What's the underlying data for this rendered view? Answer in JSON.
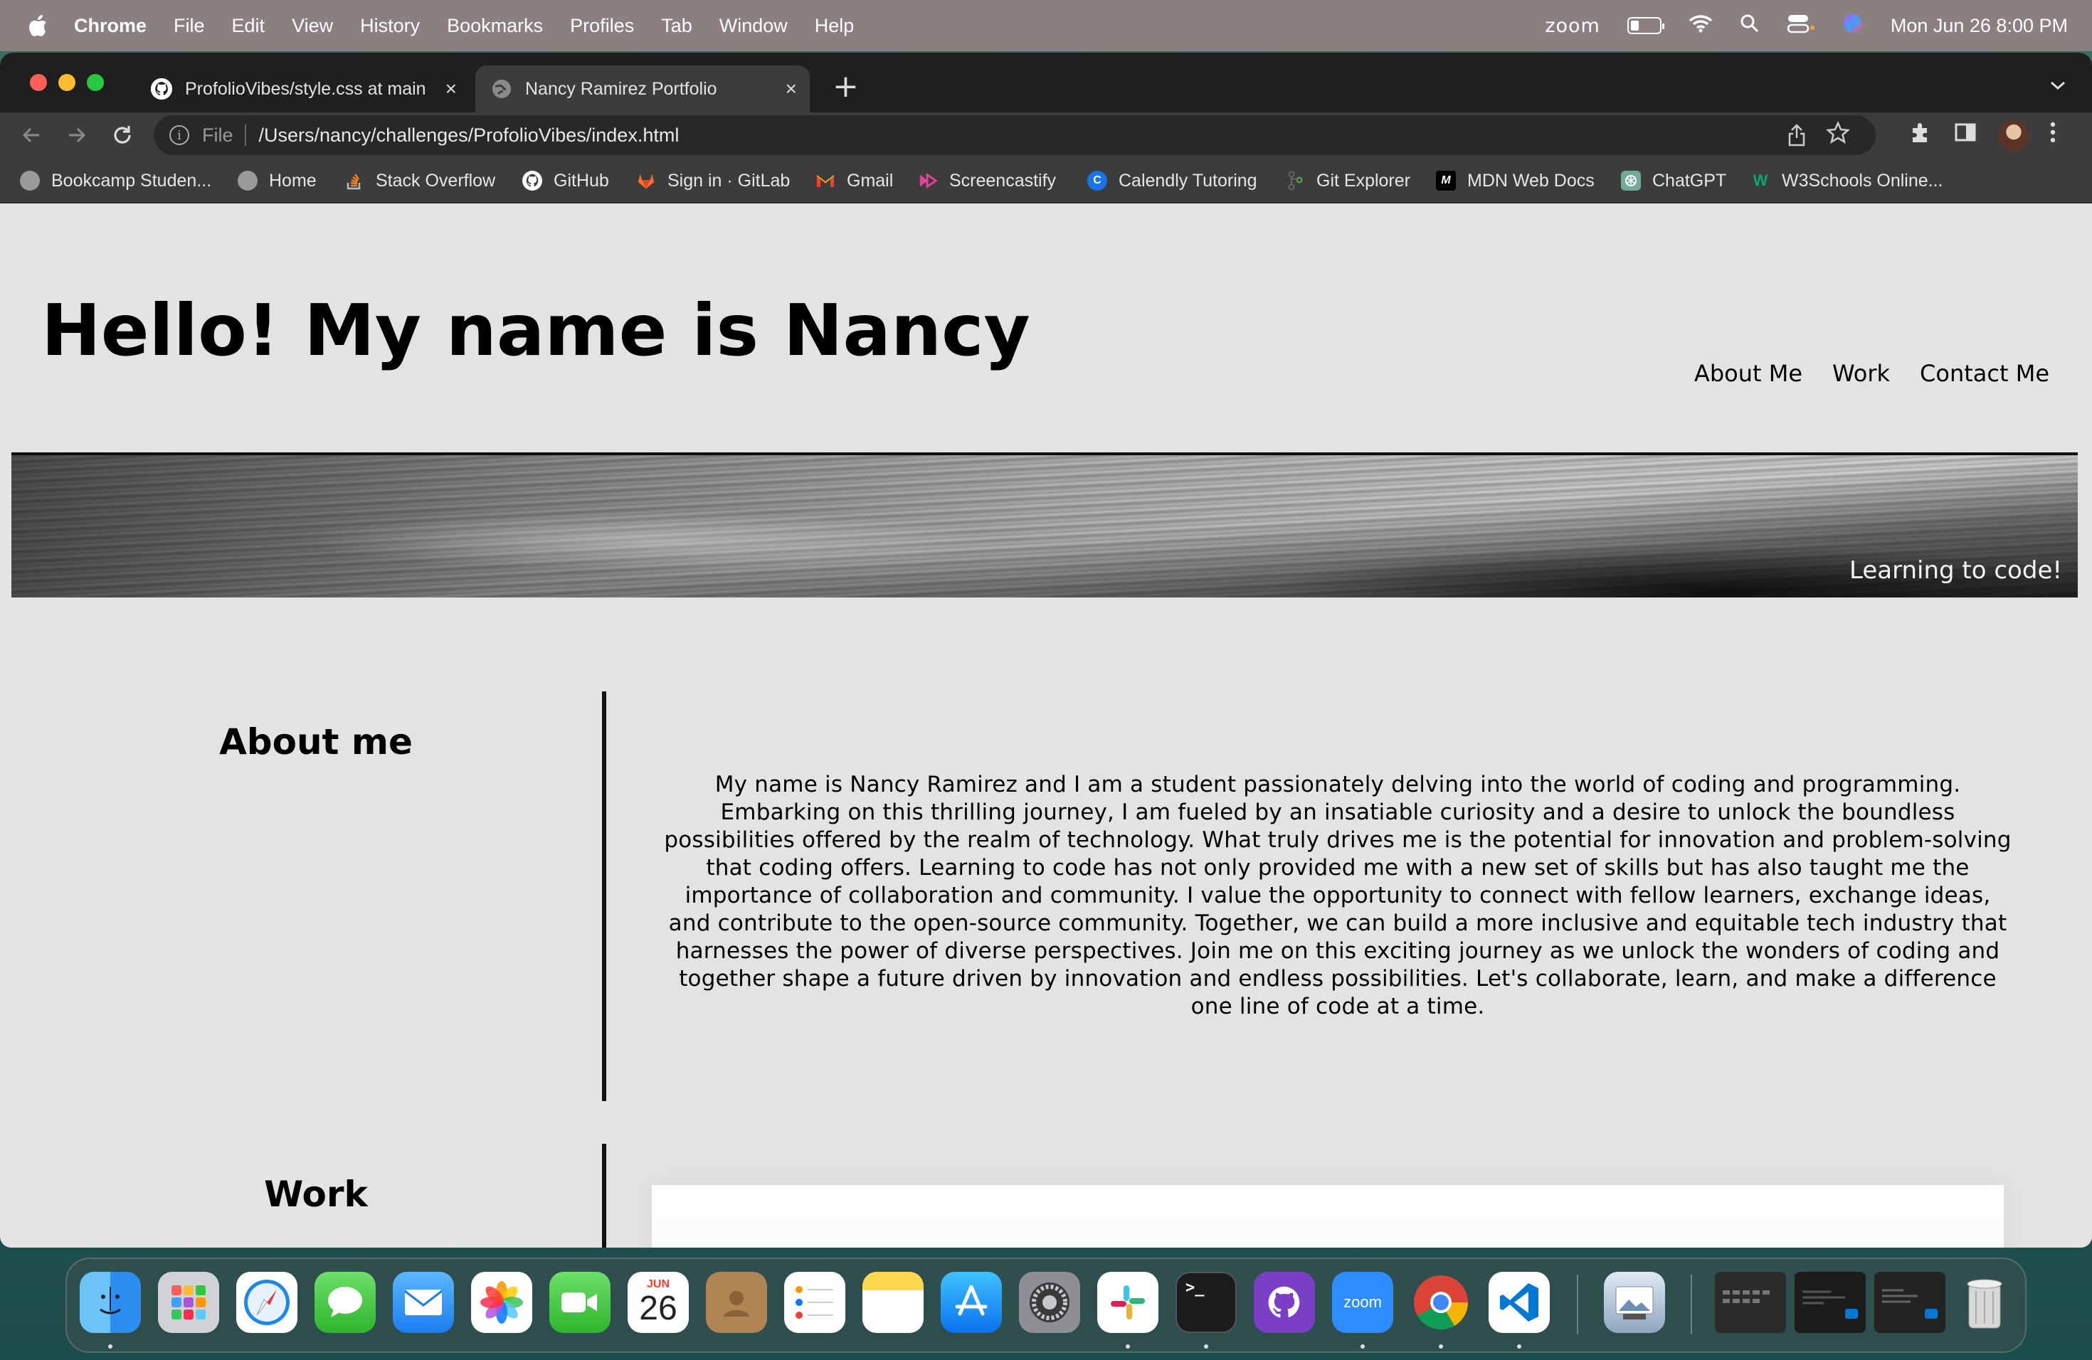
{
  "menubar": {
    "app": "Chrome",
    "items": [
      "File",
      "Edit",
      "View",
      "History",
      "Bookmarks",
      "Profiles",
      "Tab",
      "Window",
      "Help"
    ],
    "zoom": "zoom",
    "battery_level": 0.3,
    "datetime": "Mon Jun 26  8:00 PM"
  },
  "browser": {
    "tabs": [
      {
        "title": "ProfolioVibes/style.css at main",
        "active": false,
        "icon": "github-icon"
      },
      {
        "title": "Nancy Ramirez Portfolio",
        "active": true,
        "icon": "globe-icon"
      }
    ],
    "new_tab": "+",
    "address": {
      "scheme": "File",
      "url": "/Users/nancy/challenges/ProfolioVibes/index.html"
    },
    "bookmarks": [
      {
        "label": "Bookcamp Studen...",
        "icon": "globe-icon"
      },
      {
        "label": "Home",
        "icon": "globe-icon"
      },
      {
        "label": "Stack Overflow",
        "icon": "stackoverflow-icon"
      },
      {
        "label": "GitHub",
        "icon": "github-icon"
      },
      {
        "label": "Sign in · GitLab",
        "icon": "gitlab-icon"
      },
      {
        "label": "Gmail",
        "icon": "gmail-icon"
      },
      {
        "label": "Screencastify",
        "icon": "screencastify-icon"
      },
      {
        "label": "Calendly Tutoring",
        "icon": "calendly-icon"
      },
      {
        "label": "Git Explorer",
        "icon": "git-icon"
      },
      {
        "label": "MDN Web Docs",
        "icon": "mdn-icon"
      },
      {
        "label": "ChatGPT",
        "icon": "chatgpt-icon"
      },
      {
        "label": "W3Schools Online...",
        "icon": "w3schools-icon"
      }
    ]
  },
  "page": {
    "heading": "Hello! My name is Nancy",
    "nav": [
      "About Me",
      "Work",
      "Contact Me"
    ],
    "banner_tagline": "Learning to code!",
    "about": {
      "title": "About me",
      "text": "My name is Nancy Ramirez and I am a student passionately delving into the world of coding and programming. Embarking on this thrilling journey, I am fueled by an insatiable curiosity and a desire to unlock the boundless possibilities offered by the realm of technology. What truly drives me is the potential for innovation and problem-solving that coding offers. Learning to code has not only provided me with a new set of skills but has also taught me the importance of collaboration and community. I value the opportunity to connect with fellow learners, exchange ideas, and contribute to the open-source community. Together, we can build a more inclusive and equitable tech industry that harnesses the power of diverse perspectives. Join me on this exciting journey as we unlock the wonders of coding and together shape a future driven by innovation and endless possibilities. Let's collaborate, learn, and make a difference one line of code at a time."
    },
    "work": {
      "title": "Work"
    }
  },
  "dock": {
    "calendar_month": "JUN",
    "calendar_day": "26",
    "zoom_label": "zoom",
    "apps": [
      "finder-icon",
      "launchpad-icon",
      "safari-icon",
      "messages-icon",
      "mail-icon",
      "photos-icon",
      "facetime-icon",
      "calendar-icon",
      "contacts-icon",
      "reminders-icon",
      "notes-icon",
      "appstore-icon",
      "settings-icon",
      "slack-icon",
      "terminal-icon",
      "github-desktop-icon",
      "zoom-icon",
      "chrome-icon",
      "vscode-icon",
      "preview-icon",
      "trash-icon"
    ]
  },
  "colors": {
    "menubar": "#8c7f80",
    "tab_bar": "#1f1f1f",
    "toolbar": "#3c3c3c",
    "page_bg": "#e4e3e2"
  }
}
